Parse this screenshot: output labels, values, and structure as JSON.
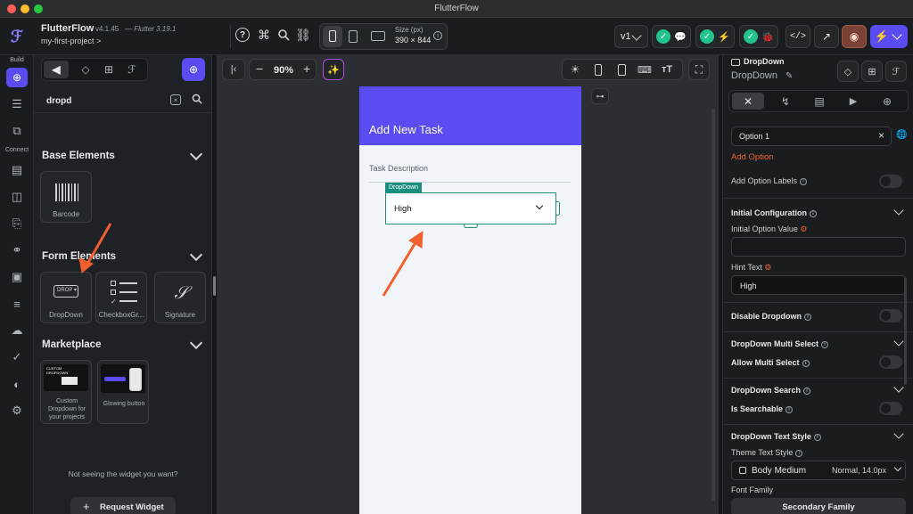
{
  "window": {
    "title": "FlutterFlow"
  },
  "app": {
    "name": "FlutterFlow",
    "version": "v4.1.45",
    "flutter": "— Flutter 3.19.1",
    "project": "my-first-project >",
    "size_label": "Size (px)",
    "size_value": "390 × 844",
    "branch": "v1"
  },
  "rail": {
    "build": "Build",
    "connect": "Connect"
  },
  "panel": {
    "search": "dropd",
    "sections": {
      "base": "Base Elements",
      "form": "Form Elements",
      "market": "Marketplace"
    },
    "items": {
      "barcode": "Barcode",
      "dropdown": "DropDown",
      "checkbox": "CheckboxGr...",
      "signature": "Signature",
      "custom_dropdown": "Custom Dropdown for your projects",
      "glowing": "Glowing button"
    },
    "dropicon_text": "DROP",
    "custom_preview": "CUSTOM DROPDOWN",
    "not_seeing": "Not seeing the widget you want?",
    "request": "Request Widget"
  },
  "canvas": {
    "zoom": "90%",
    "appbar_title": "Add New Task",
    "task_label": "Task Description",
    "dd_tag": "DropDown",
    "dd_value": "High"
  },
  "props": {
    "widget_type": "DropDown",
    "widget_name": "DropDown",
    "option1": "Option 1",
    "add_option": "Add Option",
    "add_option_labels": "Add Option Labels",
    "initial_config": "Initial Configuration",
    "initial_option_value": "Initial Option Value",
    "hint_text": "Hint Text",
    "hint_value": "High",
    "disable_dropdown": "Disable Dropdown",
    "multi_select_head": "DropDown Multi Select",
    "allow_multi": "Allow Multi Select",
    "search_head": "DropDown Search",
    "is_searchable": "Is Searchable",
    "text_style_head": "DropDown Text Style",
    "theme_text_style": "Theme Text Style",
    "body_medium": "Body Medium",
    "normal": "Normal, 14.0px",
    "font_family": "Font Family",
    "secondary_family": "Secondary Family"
  },
  "colors": {
    "accent": "#5a4cf0",
    "teal": "#1b8f7f",
    "orange": "#f0602c",
    "green": "#22c38e"
  }
}
